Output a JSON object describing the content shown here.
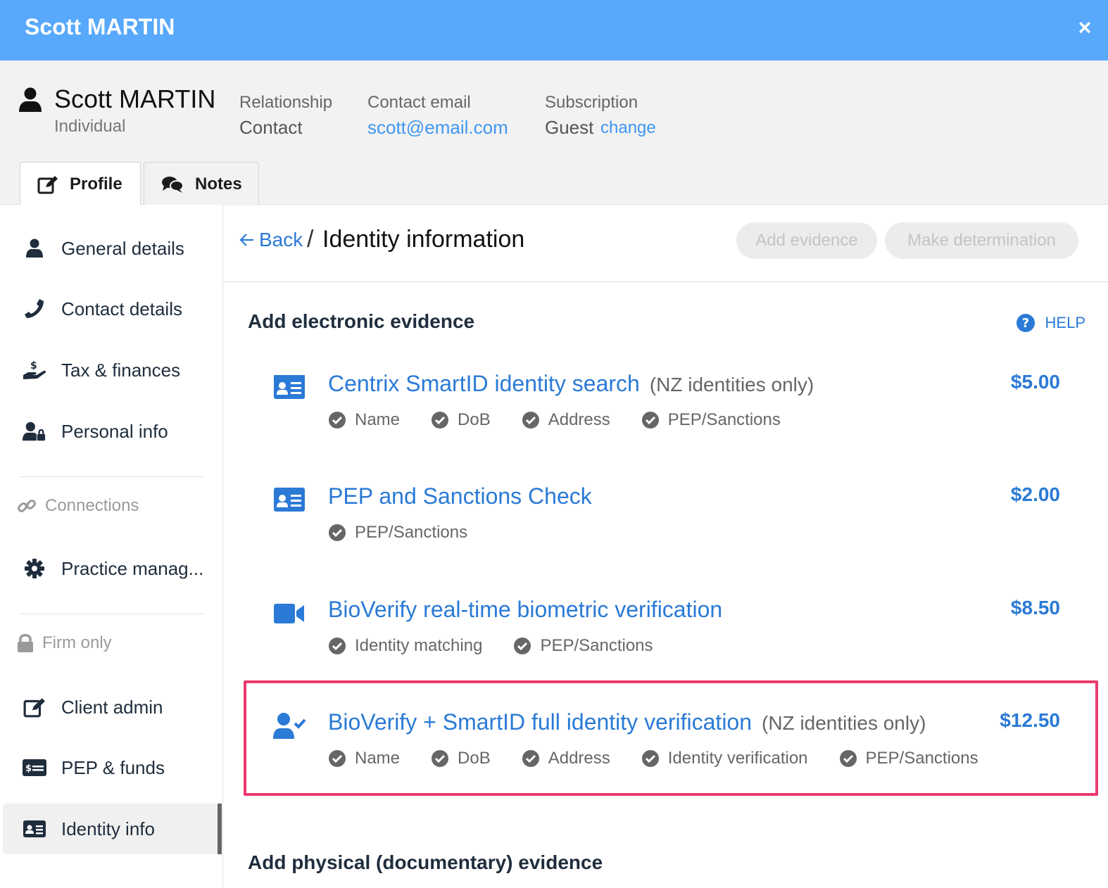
{
  "window": {
    "title": "Scott MARTIN",
    "close_glyph": "×"
  },
  "header": {
    "name": "Scott MARTIN",
    "type": "Individual",
    "relationship_label": "Relationship",
    "relationship_value": "Contact",
    "email_label": "Contact email",
    "email_value": "scott@email.com",
    "subscription_label": "Subscription",
    "subscription_value": "Guest",
    "subscription_change": "change"
  },
  "tabs": [
    {
      "label": "Profile",
      "icon": "edit-icon",
      "active": true
    },
    {
      "label": "Notes",
      "icon": "comments-icon",
      "active": false
    }
  ],
  "sidebar": {
    "items": [
      {
        "label": "General details",
        "icon": "user-icon"
      },
      {
        "label": "Contact details",
        "icon": "phone-icon"
      },
      {
        "label": "Tax & finances",
        "icon": "hand-dollar-icon"
      },
      {
        "label": "Personal info",
        "icon": "user-lock-icon"
      }
    ],
    "connections_label": "Connections",
    "practice_label": "Practice manag...",
    "firm_only_label": "Firm only",
    "firm_items": [
      {
        "label": "Client admin",
        "icon": "edit-icon"
      },
      {
        "label": "PEP & funds",
        "icon": "money-card-icon"
      },
      {
        "label": "Identity info",
        "icon": "id-card-icon",
        "active": true
      }
    ]
  },
  "main": {
    "back_label": "Back",
    "crumb_separator": "/",
    "title": "Identity information",
    "add_evidence_label": "Add evidence",
    "make_determination_label": "Make determination",
    "electronic_heading": "Add electronic evidence",
    "help_label": "HELP",
    "physical_heading": "Add physical (documentary) evidence",
    "evidence": [
      {
        "name": "Centrix SmartID identity search",
        "note": "(NZ identities only)",
        "price": "$5.00",
        "icon": "id-card-icon",
        "checks": [
          "Name",
          "DoB",
          "Address",
          "PEP/Sanctions"
        ]
      },
      {
        "name": "PEP and Sanctions Check",
        "note": "",
        "price": "$2.00",
        "icon": "id-card-icon",
        "checks": [
          "PEP/Sanctions"
        ]
      },
      {
        "name": "BioVerify real-time biometric verification",
        "note": "",
        "price": "$8.50",
        "icon": "video-icon",
        "checks": [
          "Identity matching",
          "PEP/Sanctions"
        ]
      },
      {
        "name": "BioVerify + SmartID full identity verification",
        "note": "(NZ identities only)",
        "price": "$12.50",
        "icon": "user-check-icon",
        "checks": [
          "Name",
          "DoB",
          "Address",
          "Identity verification",
          "PEP/Sanctions"
        ],
        "highlighted": true
      }
    ]
  },
  "colors": {
    "titlebar": "#58a8fb",
    "link": "#2a7ad6",
    "highlight": "#ec3a6f"
  }
}
